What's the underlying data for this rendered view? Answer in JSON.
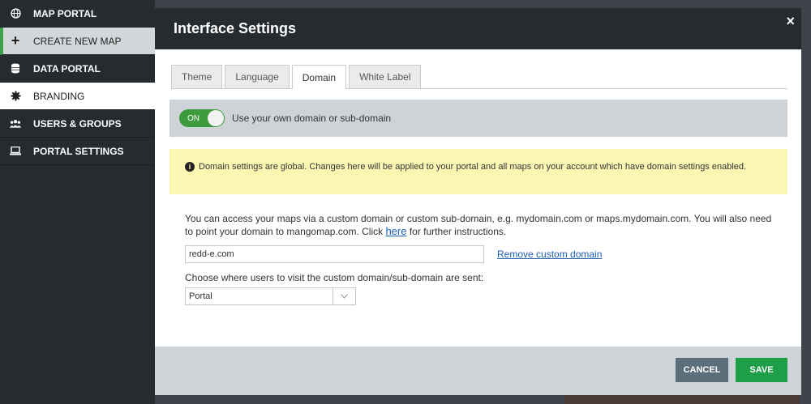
{
  "sidebar": {
    "items": [
      {
        "label": "MAP PORTAL",
        "icon": "globe-icon"
      },
      {
        "label": "CREATE NEW MAP",
        "icon": "plus-icon"
      },
      {
        "label": "DATA PORTAL",
        "icon": "database-icon"
      },
      {
        "label": "BRANDING",
        "icon": "gear-icon"
      },
      {
        "label": "USERS & GROUPS",
        "icon": "users-icon"
      },
      {
        "label": "PORTAL SETTINGS",
        "icon": "laptop-icon"
      }
    ]
  },
  "modal": {
    "title": "Interface Settings",
    "close": "×",
    "tabs": [
      {
        "label": "Theme",
        "active": false
      },
      {
        "label": "Language",
        "active": false
      },
      {
        "label": "Domain",
        "active": true
      },
      {
        "label": "White Label",
        "active": false
      }
    ],
    "toggle": {
      "state": "ON",
      "label": "Use your own domain or sub-domain"
    },
    "notice": {
      "icon": "info-icon",
      "text": "Domain settings are global. Changes here will be applied to your portal and all maps on your account which have domain settings enabled."
    },
    "description": {
      "before_link": "You can access your maps via a custom domain or custom sub-domain, e.g. mydomain.com or maps.mydomain.com. You will also need to point your domain to mangomap.com. Click ",
      "link": "here",
      "after_link": " for further instructions."
    },
    "domain_input": {
      "value": "redd-e.com"
    },
    "remove_link": "Remove custom domain",
    "redirect_label": "Choose where users to visit the custom domain/sub-domain are sent:",
    "redirect_select": {
      "value": "Portal"
    },
    "buttons": {
      "cancel": "CANCEL",
      "save": "SAVE"
    }
  },
  "colors": {
    "accent_green": "#1e9e46",
    "cancel_gray": "#5b6f7b",
    "header_dark": "#262b2f",
    "notice_yellow": "#fbf7b3"
  }
}
